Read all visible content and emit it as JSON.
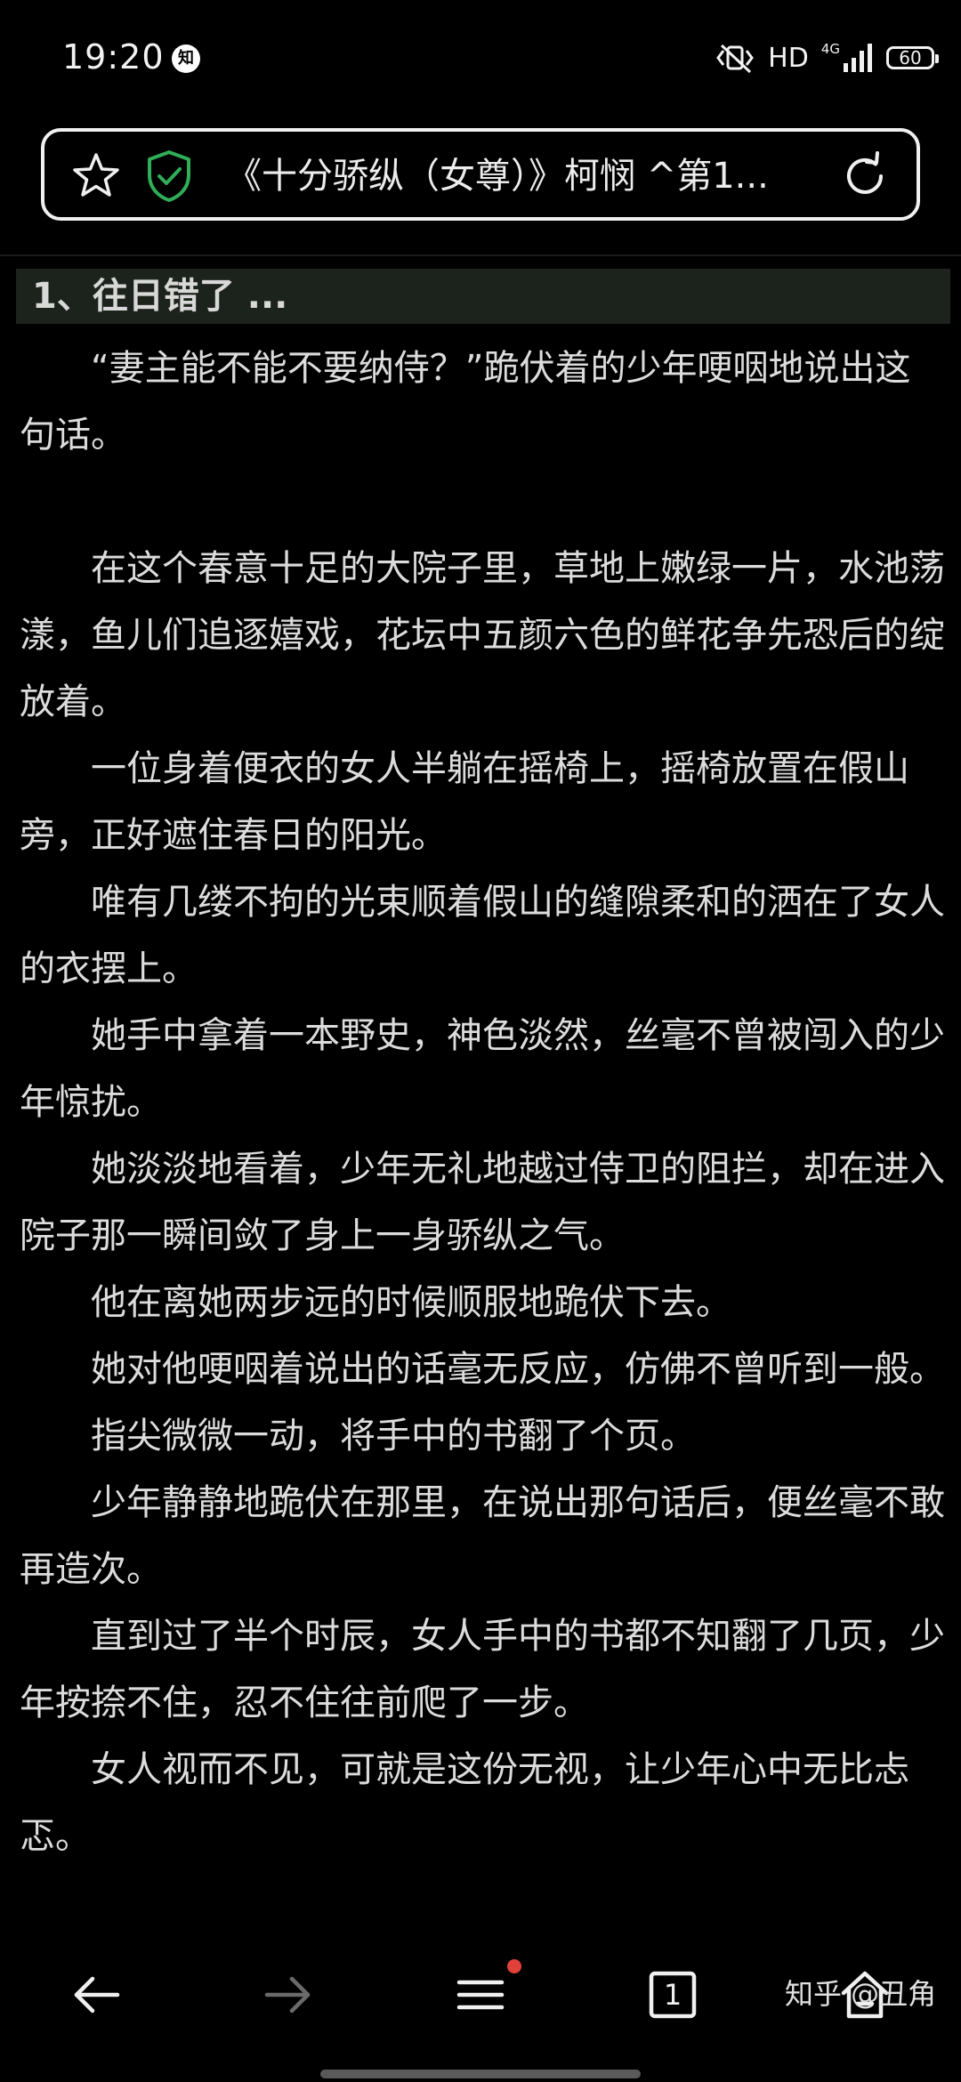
{
  "status_bar": {
    "time": "19:20",
    "notification_badge": "知",
    "hd": "HD",
    "network": "4G",
    "battery": "60"
  },
  "address_bar": {
    "title": "《十分骄纵（女尊）》柯悯 ^第1..."
  },
  "chapter": {
    "title": "1、往日错了 ..."
  },
  "article": {
    "paragraphs": [
      "“妻主能不能不要纳侍？”跪伏着的少年哽咽地说出这句话。",
      "",
      "在这个春意十足的大院子里，草地上嫩绿一片，水池荡漾，鱼儿们追逐嬉戏，花坛中五颜六色的鲜花争先恐后的绽放着。",
      "一位身着便衣的女人半躺在摇椅上，摇椅放置在假山旁，正好遮住春日的阳光。",
      "唯有几缕不拘的光束顺着假山的缝隙柔和的洒在了女人的衣摆上。",
      "她手中拿着一本野史，神色淡然，丝毫不曾被闯入的少年惊扰。",
      "她淡淡地看着，少年无礼地越过侍卫的阻拦，却在进入院子那一瞬间敛了身上一身骄纵之气。",
      "他在离她两步远的时候顺服地跪伏下去。",
      "她对他哽咽着说出的话毫无反应，仿佛不曾听到一般。",
      "指尖微微一动，将手中的书翻了个页。",
      "少年静静地跪伏在那里，在说出那句话后，便丝毫不敢再造次。",
      "直到过了半个时辰，女人手中的书都不知翻了几页，少年按捺不住，忍不住往前爬了一步。",
      "女人视而不见，可就是这份无视，让少年心中无比忐忑。"
    ]
  },
  "bottom_nav": {
    "tab_count": "1",
    "watermark": "知乎 @丑角"
  },
  "colors": {
    "background": "#000000",
    "text": "#dcdcdc",
    "shield": "#2fae57",
    "chapter_bg": "#1c221c",
    "notification_dot": "#e0413a",
    "disabled": "#6a6a6a"
  },
  "icons": {
    "star": "star-icon",
    "shield": "shield-check-icon",
    "reload": "reload-icon",
    "back": "arrow-left-icon",
    "forward": "arrow-right-icon",
    "menu": "menu-icon",
    "tabs": "tabs-icon",
    "home": "home-icon"
  }
}
